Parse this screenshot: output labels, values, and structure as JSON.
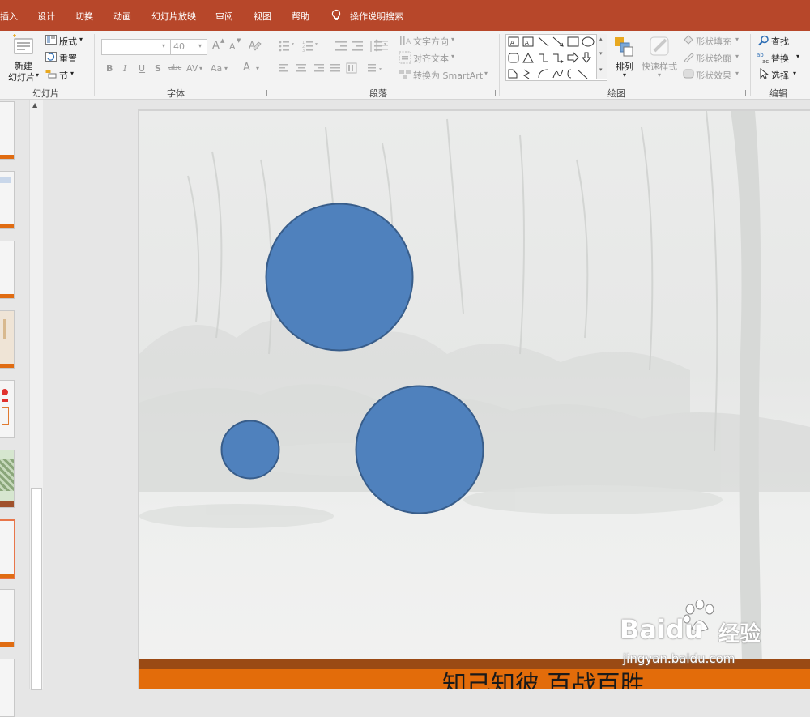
{
  "ribbon_tabs": [
    "插入",
    "设计",
    "切换",
    "动画",
    "幻灯片放映",
    "审阅",
    "视图",
    "帮助"
  ],
  "search": {
    "label": "操作说明搜索"
  },
  "slides_group": {
    "new_slide_line1": "新建",
    "new_slide_line2": "幻灯片",
    "layout": "版式",
    "reset": "重置",
    "section": "节",
    "label": "幻灯片"
  },
  "font_group": {
    "font_name": "",
    "font_size": "40",
    "bold": "B",
    "italic": "I",
    "underline": "U",
    "shadow": "S",
    "strike": "abc",
    "spacing": "AV",
    "case": "Aa",
    "color": "A",
    "grow": "A",
    "shrink": "A",
    "label": "字体"
  },
  "paragraph_group": {
    "text_direction": "文字方向",
    "align_text": "对齐文本",
    "convert_smartart": "转换为 SmartArt",
    "label": "段落"
  },
  "drawing_group": {
    "arrange": "排列",
    "quick_styles": "快速样式",
    "shape_fill": "形状填充",
    "shape_outline": "形状轮廓",
    "shape_effects": "形状效果",
    "label": "绘图"
  },
  "editing_group": {
    "find": "查找",
    "replace": "替换",
    "select": "选择",
    "label": "编辑"
  },
  "slide": {
    "footer_text": "知己知彼 百战百胜",
    "circles": [
      {
        "name": "large-circle",
        "color": "#4f81bd"
      },
      {
        "name": "small-circle",
        "color": "#4f81bd"
      },
      {
        "name": "medium-circle",
        "color": "#4f81bd"
      }
    ]
  },
  "watermark": {
    "brand": "Baidu",
    "brand_cn": "经验",
    "url": "jingyan.baidu.com"
  },
  "colors": {
    "accent": "#b7472a",
    "footer": "#e36c0a",
    "footer_dark": "#9a4a14",
    "shape_fill": "#4f81bd",
    "shape_stroke": "#385d8a"
  }
}
